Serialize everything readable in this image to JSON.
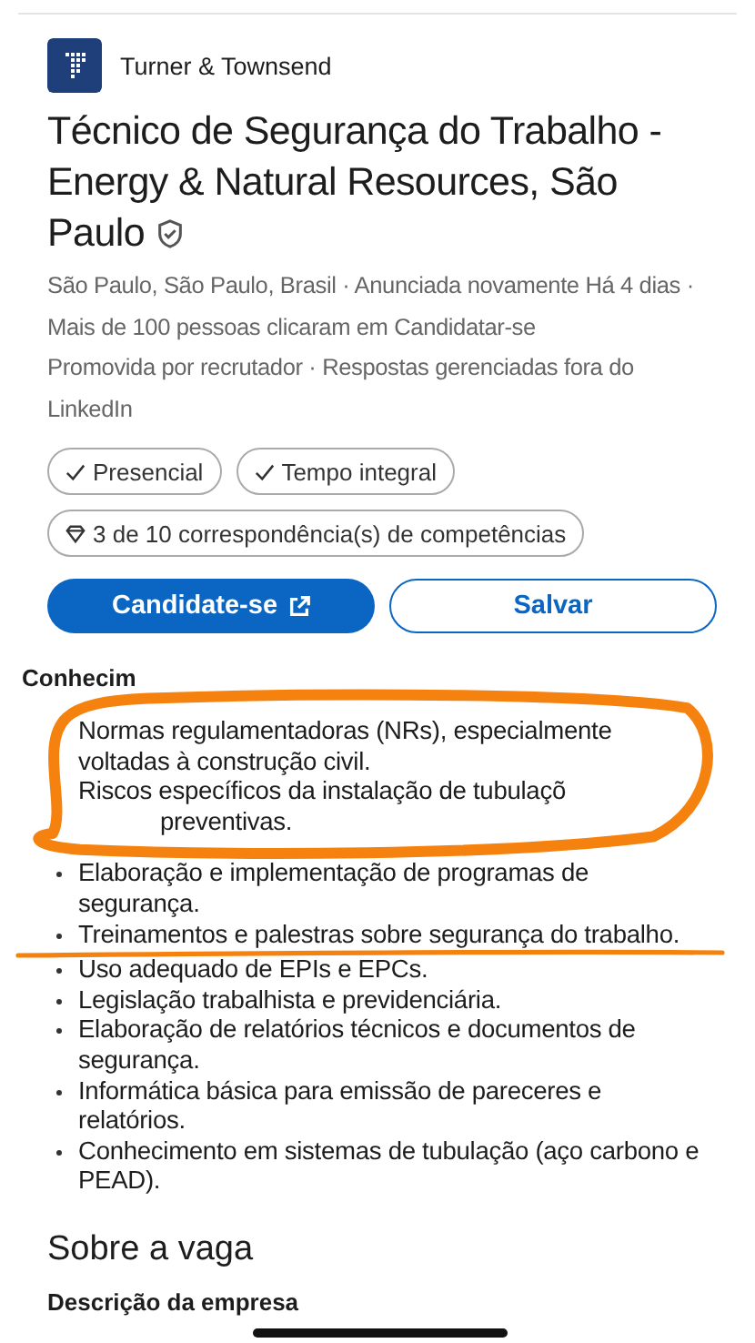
{
  "company": {
    "name": "Turner & Townsend"
  },
  "job": {
    "title": "Técnico de Segurança do Trabalho - Energy & Natural Resources, São Paulo",
    "verified": true,
    "meta": [
      "São Paulo, São Paulo, Brasil · Anunciada novamente Há 4 dias · Mais de 100 pessoas clicaram em Candidatar-se",
      "Promovida por recrutador · Respostas gerenciadas fora do LinkedIn"
    ]
  },
  "chips": [
    {
      "kind": "check",
      "label": "Presencial"
    },
    {
      "kind": "check",
      "label": "Tempo integral"
    },
    {
      "kind": "skills",
      "label": "3 de 10 correspondência(s) de competências"
    }
  ],
  "buttons": [
    {
      "kind": "primary",
      "label": "Candidate-se"
    },
    {
      "kind": "secondary",
      "label": "Salvar"
    }
  ],
  "skills_section": {
    "heading": "Conhecim",
    "items": [
      {
        "text": "Normas regulamentadoras (NRs), especialmente voltadas à construção civil.",
        "bullet": false,
        "circled": true
      },
      {
        "text": "Riscos específicos da instalação de tubulaçõ",
        "continuation": "preventivas.",
        "bullet": false,
        "circled": true
      },
      {
        "text": "Elaboração e implementação de programas de segurança.",
        "bullet": true
      },
      {
        "text": "Treinamentos e palestras sobre segurança do trabalho.",
        "bullet": true,
        "underlined": true
      },
      {
        "text": "Uso adequado de EPIs e EPCs.",
        "bullet": true
      },
      {
        "text": "Legislação trabalhista e previdenciária.",
        "bullet": true
      },
      {
        "text": "Elaboração de relatórios técnicos e documentos de segurança.",
        "bullet": true
      },
      {
        "text": "Informática básica para emissão de pareceres e relatórios.",
        "bullet": true
      },
      {
        "text": "Conhecimento em sistemas de tubulação (aço carbono e PEAD).",
        "bullet": true
      }
    ]
  },
  "about": {
    "heading": "Sobre a vaga",
    "subheading": "Descrição da empresa"
  }
}
